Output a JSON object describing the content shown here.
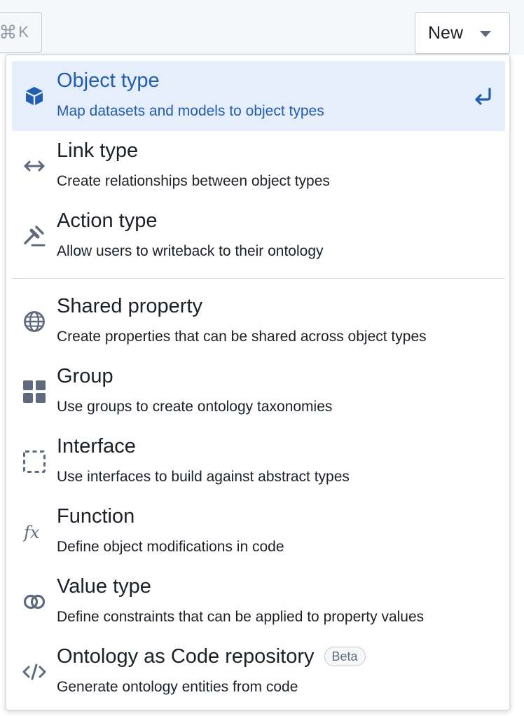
{
  "topbar": {
    "shortcut_symbol": "⌘",
    "shortcut_key": "K",
    "new_button_label": "New"
  },
  "menu": {
    "items": [
      {
        "title": "Object type",
        "description": "Map datasets and models to object types",
        "icon": "cube-icon",
        "active": true
      },
      {
        "title": "Link type",
        "description": "Create relationships between object types",
        "icon": "arrows-horizontal-icon"
      },
      {
        "title": "Action type",
        "description": "Allow users to writeback to their ontology",
        "icon": "gavel-icon"
      },
      {
        "title": "Shared property",
        "description": "Create properties that can be shared across object types",
        "icon": "globe-icon"
      },
      {
        "title": "Group",
        "description": "Use groups to create ontology taxonomies",
        "icon": "grid-icon"
      },
      {
        "title": "Interface",
        "description": "Use interfaces to build against abstract types",
        "icon": "dashed-square-icon"
      },
      {
        "title": "Function",
        "description": "Define object modifications in code",
        "icon": "function-icon"
      },
      {
        "title": "Value type",
        "description": "Define constraints that can be applied to property values",
        "icon": "intersection-icon"
      },
      {
        "title": "Ontology as Code repository",
        "badge": "Beta",
        "description": "Generate ontology entities from code",
        "icon": "code-icon"
      }
    ]
  },
  "colors": {
    "accent": "#215db0",
    "active_bg": "#e7eefb",
    "icon": "#5f6b7c",
    "text": "#1c2127"
  }
}
